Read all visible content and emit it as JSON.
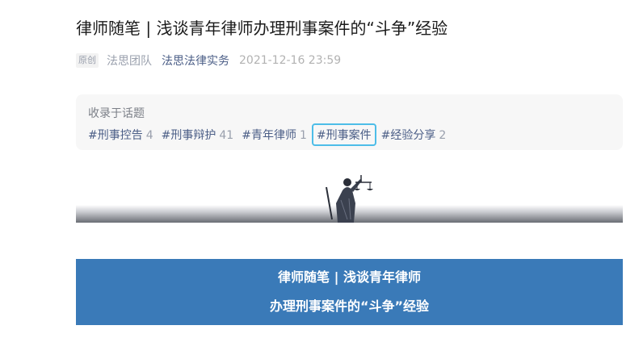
{
  "article": {
    "title": "律师随笔 | 浅谈青年律师办理刑事案件的“斗争”经验",
    "badge": "原创",
    "author": "法思团队",
    "account": "法思法律实务",
    "time": "2021-12-16 23:59"
  },
  "topics": {
    "heading": "收录于话题",
    "tags": [
      {
        "label": "#刑事控告",
        "count": "4"
      },
      {
        "label": "#刑事辩护",
        "count": "41"
      },
      {
        "label": "#青年律师",
        "count": "1"
      },
      {
        "label": "#刑事案件",
        "count": ""
      },
      {
        "label": "#经验分享",
        "count": "2"
      }
    ],
    "selected_color": "#4dbde8"
  },
  "banner": {
    "line1": "律师随笔 | 浅谈青年律师",
    "line2": "办理刑事案件的“斗争”经验",
    "background": "#3a7ab8"
  },
  "images": {
    "statue_icon": "justice-statue-icon"
  }
}
